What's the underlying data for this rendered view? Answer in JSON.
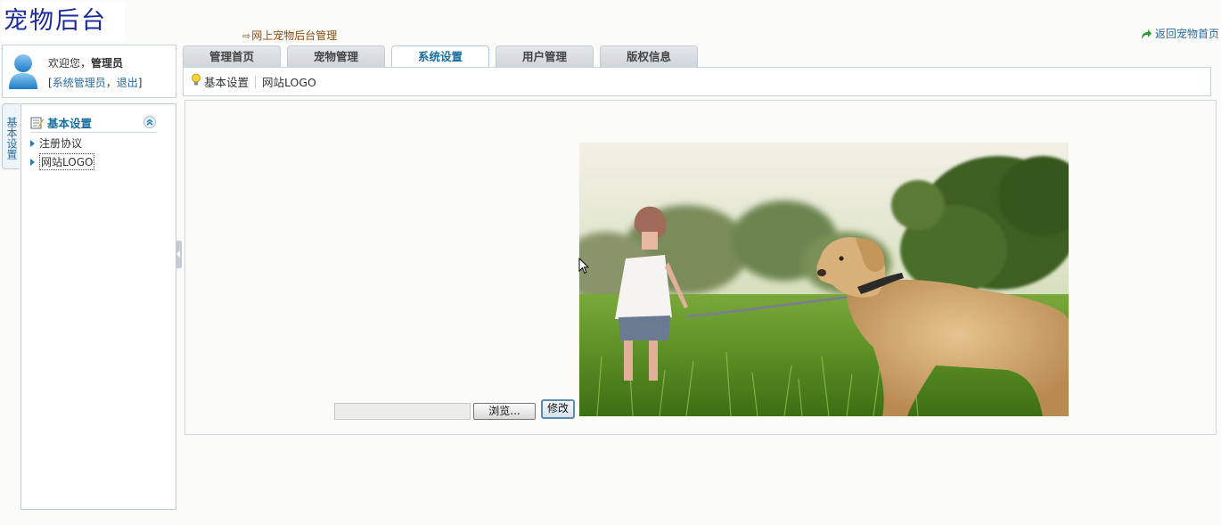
{
  "header": {
    "logo_text": "宠物后台",
    "top_title": "网上宠物后台管理",
    "return_link": "返回宠物首页"
  },
  "user": {
    "welcome_prefix": "欢迎您，",
    "username": "管理员",
    "bracket_open": "[",
    "role_link": "系统管理员",
    "comma": "，",
    "logout_link": "退出",
    "bracket_close": "]"
  },
  "tabs": [
    {
      "label": "管理首页"
    },
    {
      "label": "宠物管理"
    },
    {
      "label": "系统设置"
    },
    {
      "label": "用户管理"
    },
    {
      "label": "版权信息"
    }
  ],
  "active_tab": "系统设置",
  "breadcrumb": {
    "level1": "基本设置",
    "level2": "网站LOGO"
  },
  "sidebar": {
    "vertical_tab": "基本设置",
    "section_title": "基本设置",
    "items": [
      {
        "label": "注册协议"
      },
      {
        "label": "网站LOGO"
      }
    ],
    "selected_item": "网站LOGO"
  },
  "form": {
    "file_value": "",
    "browse_label": "浏览...",
    "submit_label": "修改"
  },
  "colors": {
    "accent_blue": "#1a6fa0",
    "link_blue": "#2a6aa0",
    "logo_blue": "#1a2a9a",
    "title_brown": "#8a4a10"
  },
  "icons": {
    "return": "arrow-return-icon",
    "avatar": "user-avatar-icon",
    "breadcrumb": "lightbulb-icon",
    "section": "edit-note-icon",
    "collapse": "double-chevron-up-icon"
  }
}
